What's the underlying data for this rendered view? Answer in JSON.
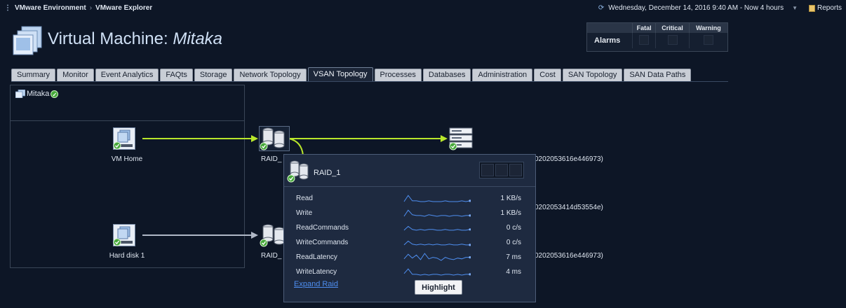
{
  "breadcrumb": {
    "items": [
      "VMware Environment",
      "VMware Explorer"
    ]
  },
  "header": {
    "time_range": "Wednesday, December 14, 2016 9:40 AM - Now 4 hours",
    "reports_label": "Reports",
    "title_prefix": "Virtual Machine:",
    "title_name": "Mitaka"
  },
  "alarms": {
    "label": "Alarms",
    "columns": [
      "Fatal",
      "Critical",
      "Warning"
    ]
  },
  "tabs": [
    {
      "label": "Summary"
    },
    {
      "label": "Monitor"
    },
    {
      "label": "Event Analytics"
    },
    {
      "label": "FAQts"
    },
    {
      "label": "Storage"
    },
    {
      "label": "Network Topology"
    },
    {
      "label": "VSAN Topology",
      "active": true
    },
    {
      "label": "Processes"
    },
    {
      "label": "Databases"
    },
    {
      "label": "Administration"
    },
    {
      "label": "Cost"
    },
    {
      "label": "SAN Topology"
    },
    {
      "label": "SAN Data Paths"
    }
  ],
  "topology": {
    "vm_name": "Mitaka",
    "vm_home_label": "VM Home",
    "hard_disk_label": "Hard disk 1",
    "raid_label_1": "RAID_",
    "raid_label_2": "RAID_",
    "guid_1": "0202053616e446973)",
    "guid_2": "0202053414d53554e)",
    "guid_3": "0202053616e446973)"
  },
  "popup": {
    "title": "RAID_1",
    "metrics": [
      {
        "name": "Read",
        "value": "1 KB/s",
        "spark": [
          10,
          2,
          9,
          9,
          10,
          10,
          9,
          10,
          10,
          10,
          9,
          10,
          10,
          10,
          9,
          10,
          9
        ]
      },
      {
        "name": "Write",
        "value": "1 KB/s",
        "spark": [
          10,
          2,
          8,
          9,
          9,
          10,
          8,
          9,
          10,
          9,
          9,
          10,
          9,
          9,
          10,
          9,
          9
        ]
      },
      {
        "name": "ReadCommands",
        "value": "0 c/s",
        "spark": [
          9,
          4,
          8,
          9,
          8,
          9,
          8,
          8,
          9,
          9,
          8,
          9,
          9,
          8,
          9,
          9,
          8
        ]
      },
      {
        "name": "WriteCommands",
        "value": "0 c/s",
        "spark": [
          9,
          4,
          8,
          9,
          8,
          9,
          8,
          9,
          8,
          9,
          9,
          8,
          9,
          9,
          8,
          9,
          9
        ]
      },
      {
        "name": "ReadLatency",
        "value": "7 ms",
        "spark": [
          8,
          2,
          7,
          3,
          9,
          1,
          8,
          6,
          7,
          10,
          6,
          8,
          9,
          7,
          8,
          6,
          6
        ]
      },
      {
        "name": "WriteLatency",
        "value": "4 ms",
        "spark": [
          8,
          2,
          9,
          9,
          10,
          9,
          10,
          9,
          9,
          10,
          9,
          9,
          10,
          9,
          10,
          9,
          9
        ]
      }
    ],
    "expand_label": "Expand Raid",
    "highlight_label": "Highlight"
  },
  "colors": {
    "active_link": "#b8e62b",
    "inactive_link": "#b0b8c6",
    "accent": "#4e8ef0",
    "background": "#0d1626"
  }
}
